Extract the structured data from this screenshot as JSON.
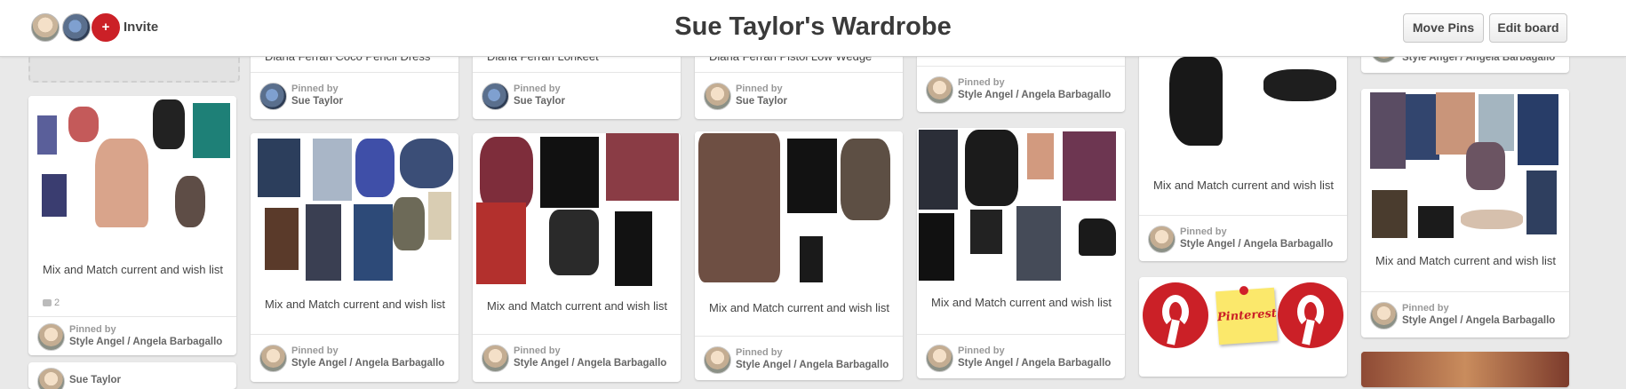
{
  "header": {
    "title": "Sue Taylor's Wardrobe",
    "invite_label": "Invite",
    "avatar_add_glyph": "+",
    "move_pins_label": "Move Pins",
    "edit_board_label": "Edit board"
  },
  "pins": {
    "c1": {
      "desc": "Mix and Match current and wish list",
      "comments": "2",
      "pinned_label": "Pinned by",
      "pinned_name": "Style Angel / Angela Barbagallo",
      "next_name": "Sue Taylor"
    },
    "c2": {
      "top_desc": "Diana Ferrari Coco Pencil Dress",
      "top_pinned_label": "Pinned by",
      "top_pinned_name": "Sue Taylor",
      "desc": "Mix and Match current and wish list",
      "pinned_label": "Pinned by",
      "pinned_name": "Style Angel / Angela Barbagallo"
    },
    "c3": {
      "top_desc": "Diana Ferrari Lorikeet",
      "top_pinned_label": "Pinned by",
      "top_pinned_name": "Sue Taylor",
      "desc": "Mix and Match current and wish list",
      "pinned_label": "Pinned by",
      "pinned_name": "Style Angel / Angela Barbagallo"
    },
    "c4": {
      "top_desc": "Diana Ferrari Pistol Low Wedge",
      "top_pinned_label": "Pinned by",
      "top_pinned_name": "Sue Taylor",
      "desc": "Mix and Match current and wish list",
      "pinned_label": "Pinned by",
      "pinned_name": "Style Angel / Angela Barbagallo"
    },
    "c5": {
      "top_pinned_label": "Pinned by",
      "top_pinned_name": "Style Angel / Angela Barbagallo",
      "desc": "Mix and Match current and wish list",
      "pinned_label": "Pinned by",
      "pinned_name": "Style Angel / Angela Barbagallo"
    },
    "c6": {
      "desc": "Mix and Match current and wish list",
      "pinned_label": "Pinned by",
      "pinned_name": "Style Angel / Angela Barbagallo",
      "note_text": "Pinterest"
    },
    "c7": {
      "top_pinned_name": "Style Angel / Angela Barbagallo",
      "desc": "Mix and Match current and wish list",
      "pinned_label": "Pinned by",
      "pinned_name": "Style Angel / Angela Barbagallo"
    }
  },
  "colors": {
    "brand_red": "#cb2027",
    "background": "#e9e9e9"
  }
}
